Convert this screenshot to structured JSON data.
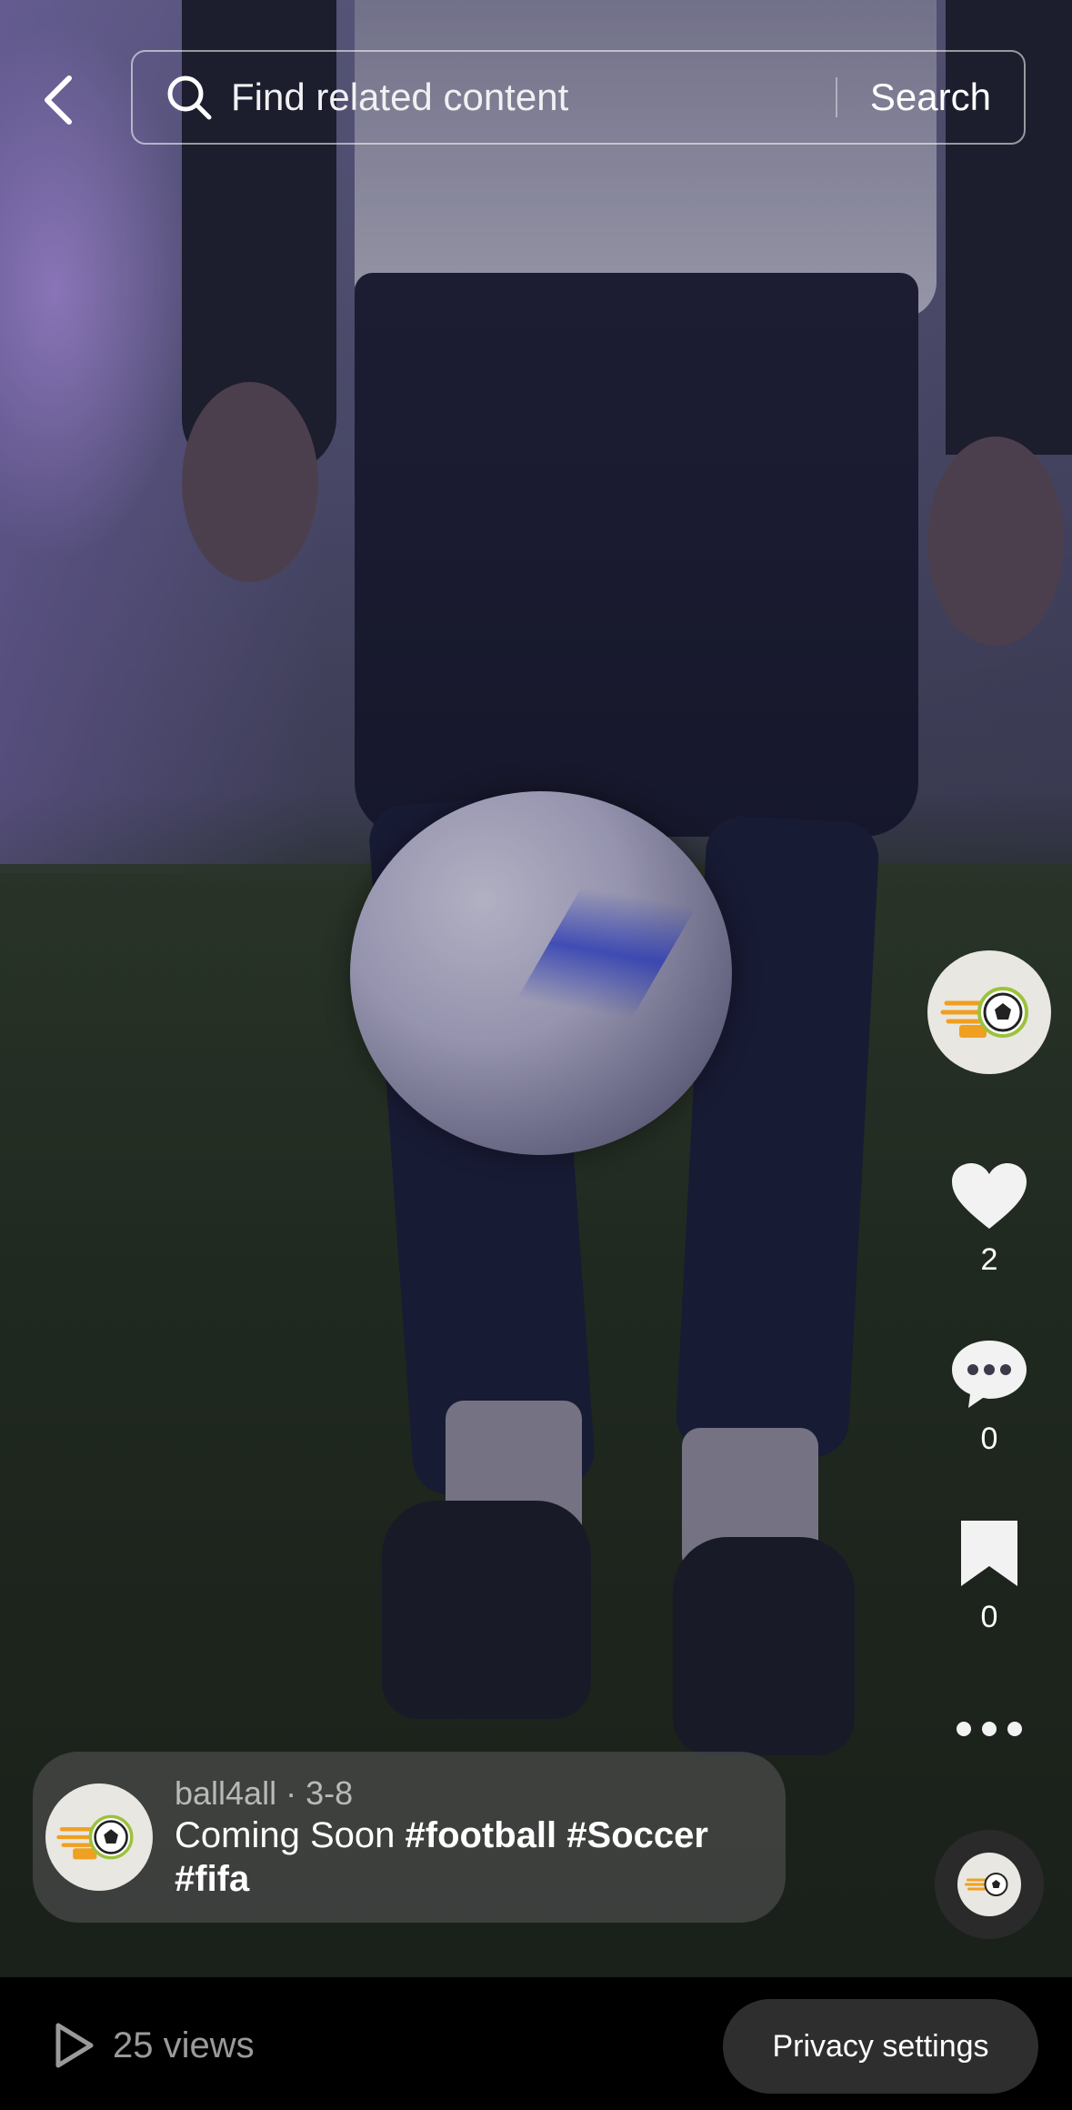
{
  "header": {
    "search_placeholder": "Find related content",
    "search_button": "Search"
  },
  "rail": {
    "likes": "2",
    "comments": "0",
    "saves": "0"
  },
  "caption": {
    "author": "ball4all",
    "date": "3-8",
    "separator": " · ",
    "text": "Coming Soon",
    "hashtags": [
      "#football",
      "#Soccer",
      "#fifa"
    ]
  },
  "footer": {
    "views": "25 views",
    "privacy": "Privacy settings"
  },
  "colors": {
    "accent_orange": "#f0a020",
    "logo_green": "#9bc23c"
  }
}
